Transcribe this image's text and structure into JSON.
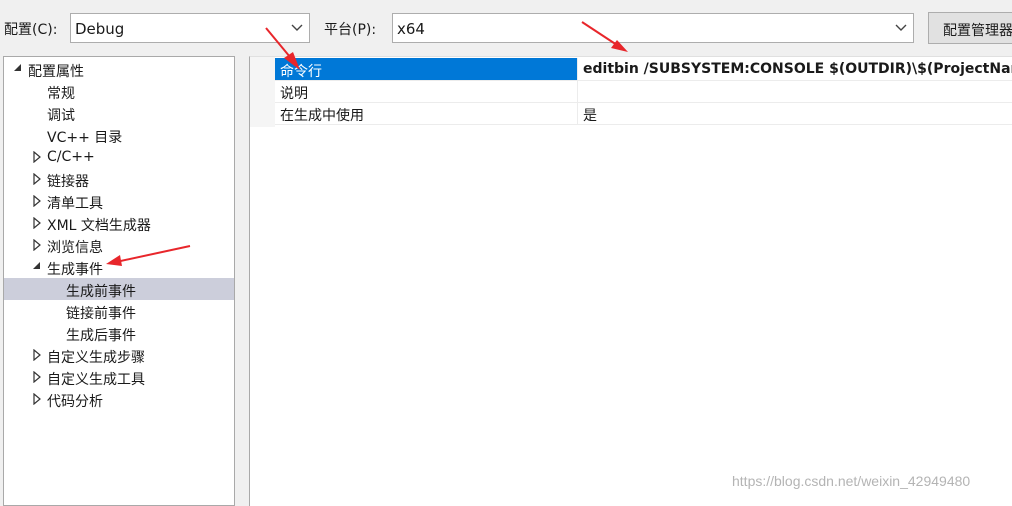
{
  "toolbar": {
    "config_label": "配置(C):",
    "config_value": "Debug",
    "platform_label": "平台(P):",
    "platform_value": "x64",
    "config_manager_button": "配置管理器"
  },
  "tree": {
    "items": [
      {
        "label": "配置属性",
        "toggle": "expanded"
      },
      {
        "label": "常规",
        "toggle": "none"
      },
      {
        "label": "调试",
        "toggle": "none"
      },
      {
        "label": "VC++ 目录",
        "toggle": "none"
      },
      {
        "label": "C/C++",
        "toggle": "collapsed"
      },
      {
        "label": "链接器",
        "toggle": "collapsed"
      },
      {
        "label": "清单工具",
        "toggle": "collapsed"
      },
      {
        "label": "XML 文档生成器",
        "toggle": "collapsed"
      },
      {
        "label": "浏览信息",
        "toggle": "collapsed"
      },
      {
        "label": "生成事件",
        "toggle": "expanded"
      },
      {
        "label": "生成前事件",
        "toggle": "none",
        "selected": true
      },
      {
        "label": "链接前事件",
        "toggle": "none"
      },
      {
        "label": "生成后事件",
        "toggle": "none"
      },
      {
        "label": "自定义生成步骤",
        "toggle": "collapsed"
      },
      {
        "label": "自定义生成工具",
        "toggle": "collapsed"
      },
      {
        "label": "代码分析",
        "toggle": "collapsed"
      }
    ]
  },
  "properties": [
    {
      "name": "命令行",
      "value": "editbin /SUBSYSTEM:CONSOLE $(OUTDIR)\\$(ProjectNam",
      "selected": true,
      "bold": true
    },
    {
      "name": "说明",
      "value": ""
    },
    {
      "name": "在生成中使用",
      "value": "是"
    }
  ],
  "watermark": "https://blog.csdn.net/weixin_42949480",
  "colors": {
    "selection_blue": "#0078d7",
    "tree_selection": "#cccedb",
    "annotation_arrow": "#e8262b"
  },
  "icons": {
    "expanded": "triangle-down-icon",
    "collapsed": "triangle-right-icon",
    "combo": "chevron-down-icon"
  }
}
